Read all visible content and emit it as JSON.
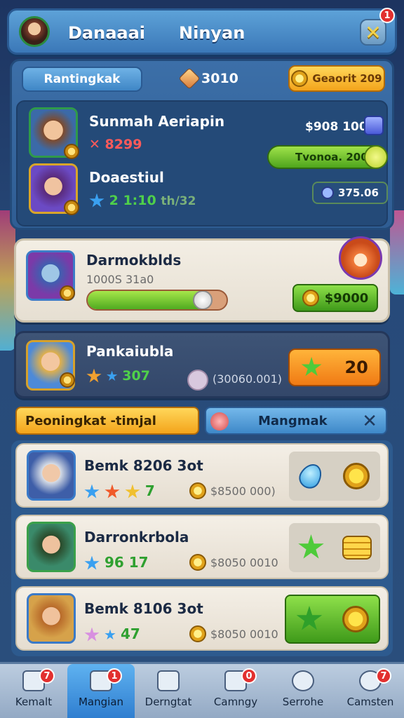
{
  "header": {
    "name_left": "Danaaai",
    "name_right": "Ninyan",
    "close_badge": "1",
    "close_symbol": "✕"
  },
  "top_panel": {
    "tab_label": "Rantingkak",
    "gem_count": "3010",
    "gold_button": "Geaorit 209",
    "row1": {
      "name": "Sunmah Aeriapin",
      "stat": "✕ 8299",
      "right_value": "$908 100",
      "bar_button": "Tvonoa. 200"
    },
    "row2": {
      "name": "Doaestiul",
      "stat": "2 1:10",
      "stat_sub": "th/32",
      "chip": "375.06"
    }
  },
  "card1": {
    "name": "Darmokblds",
    "sub": "1000S 31a0",
    "progress": 0.85,
    "price": "$9000"
  },
  "card2": {
    "name": "Pankaiubla",
    "stat": "307",
    "sub": "(30060.001)",
    "button_value": "20"
  },
  "tabs": {
    "left": "Peoningkat -timjal",
    "right": "Mangmak",
    "close": "✕"
  },
  "list": [
    {
      "name": "Bemk 8206 3ot",
      "stars": "7",
      "sub": "$8500 000)",
      "action": "drop-coin"
    },
    {
      "name": "Darronkrbola",
      "stars": "96 17",
      "sub": "$8050 0010",
      "action": "star-coins"
    },
    {
      "name": "Bemk 8106 3ot",
      "stars": "47",
      "sub": "$8050 0010",
      "action": "star-coin-green"
    }
  ],
  "bottom_nav": [
    {
      "label": "Kemalt",
      "badge": "7",
      "icon": "home-icon"
    },
    {
      "label": "Mangian",
      "badge": "1",
      "icon": "book-icon"
    },
    {
      "label": "Derngtat",
      "badge": "",
      "icon": "scroll-icon"
    },
    {
      "label": "Camngy",
      "badge": "0",
      "icon": "dice-icon"
    },
    {
      "label": "Serrohe",
      "badge": "",
      "icon": "search-icon"
    },
    {
      "label": "Camsten",
      "badge": "7",
      "icon": "chat-icon"
    }
  ],
  "colors": {
    "accent_gold": "#f3a41b",
    "accent_green": "#4ea51c",
    "accent_blue": "#3e88c8",
    "badge_red": "#e2302f"
  }
}
